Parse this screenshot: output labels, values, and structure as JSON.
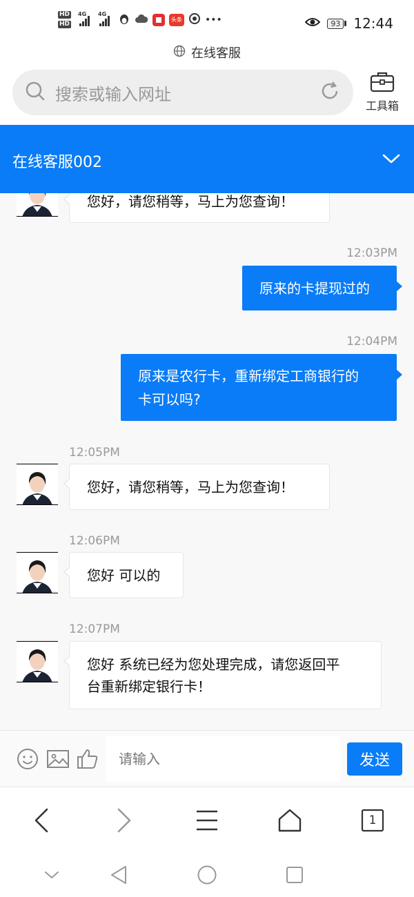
{
  "status_bar": {
    "hd1": "HD",
    "hd2": "HD",
    "net1": "4G",
    "net2": "4G",
    "battery": "93",
    "time": "12:44",
    "app_badge": "头条"
  },
  "page_title": "在线客服",
  "search": {
    "placeholder": "搜索或输入网址"
  },
  "toolbox": {
    "label": "工具箱"
  },
  "chat": {
    "title": "在线客服002",
    "messages": [
      {
        "side": "in",
        "time": "",
        "text": "您好，请您稍等，马上为您查询！"
      },
      {
        "side": "out",
        "time": "12:03PM",
        "text": "原来的卡提现过的"
      },
      {
        "side": "out",
        "time": "12:04PM",
        "text_line1": "原来是农行卡，重新绑定工商银行的",
        "text_line2": "卡可以吗?"
      },
      {
        "side": "in",
        "time": "12:05PM",
        "text": "您好，请您稍等，马上为您查询！"
      },
      {
        "side": "in",
        "time": "12:06PM",
        "text": "您好 可以的"
      },
      {
        "side": "in",
        "time": "12:07PM",
        "text_line1": "您好 系统已经为您处理完成，请您返回平",
        "text_line2": "台重新绑定银行卡！"
      }
    ]
  },
  "input": {
    "placeholder": "请输入",
    "send_label": "发送"
  },
  "browser_nav": {
    "tab_count": "1"
  },
  "colors": {
    "accent": "#0a7cf7",
    "bubble_in": "#ffffff",
    "chat_bg": "#f8f8f9"
  }
}
